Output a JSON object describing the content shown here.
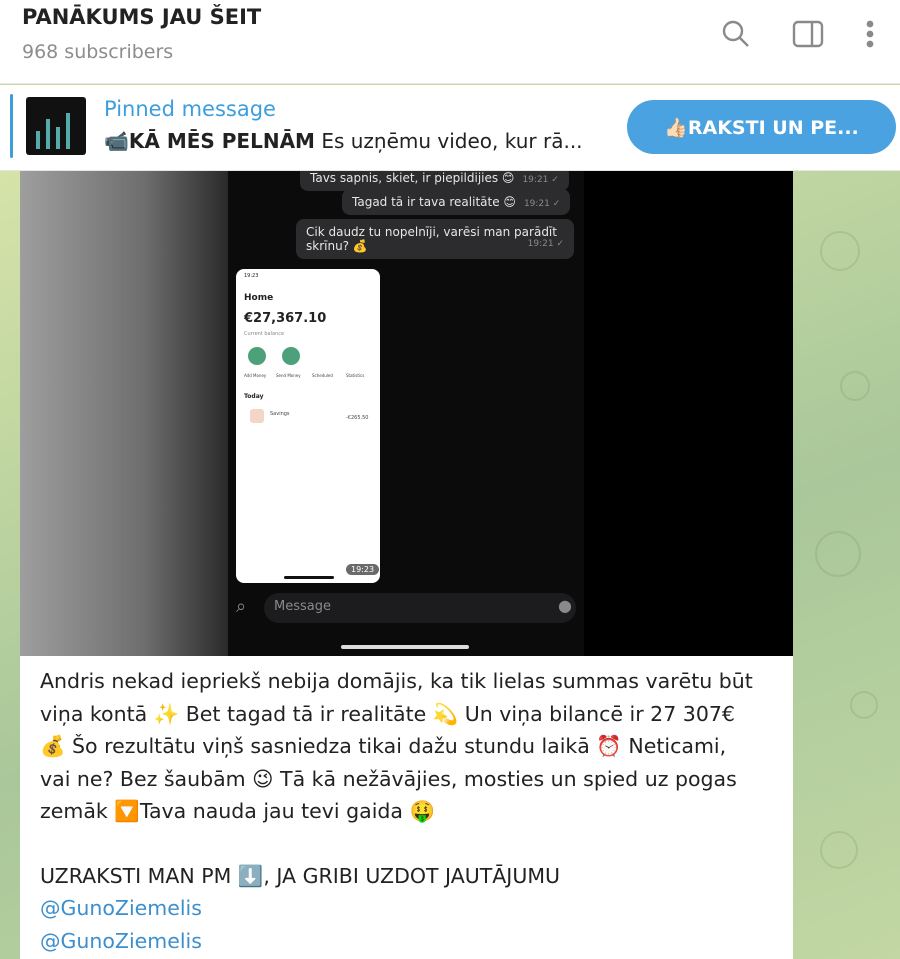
{
  "header": {
    "channel_title": "PANĀKUMS JAU ŠEIT",
    "subscribers": "968 subscribers",
    "icons": [
      "search-icon",
      "sidebar-toggle-icon",
      "more-vertical-icon"
    ]
  },
  "pinned": {
    "label": "Pinned message",
    "emoji": "📹",
    "title_bold": "KĀ MĒS PELNĀM",
    "preview": " Es uzņēmu video, kur rā...",
    "button_label": "👍🏻RAKSTI UN PE..."
  },
  "media": {
    "bubbles": {
      "b1": "Tavs sapnis, skiet, ir piepildijies 😊",
      "b1_time": "19:21 ✓",
      "b2": "Tagad tā ir tava realitāte 😊",
      "b2_time": "19:21 ✓",
      "b3_line1": "Cik daudz tu nopelnīji, varēsi man parādīt",
      "b3_line2": "skrīnu? 💰",
      "b3_time": "19:21 ✓"
    },
    "screen": {
      "status": "19:23",
      "home": "Home",
      "amount": "€27,367.10",
      "sub": "Current balance",
      "actions": [
        "Add Money",
        "Send Money",
        "Scheduled",
        "Statistics"
      ],
      "today": "Today",
      "tx_label": "Savings",
      "tx_sub": "Today",
      "tx_amount": "-€265.50",
      "time": "19:23"
    },
    "input_placeholder": "Message"
  },
  "message": {
    "lines": [
      "Andris nekad iepriekš nebija domājis, ka tik lielas summas varētu būt",
      "viņa kontā ✨ Bet tagad tā ir realitāte 💫 Un viņa bilancē ir 27 307€",
      "💰 Šo rezultātu viņš sasniedza tikai dažu stundu laikā ⏰ Neticami,",
      "vai ne? Bez šaubām 😉 Tā kā nežāvājies, mosties un spied uz pogas",
      "zemāk 🔽Tava nauda jau tevi gaida 🤑"
    ],
    "cta": "UZRAKSTI MAN PM ⬇️, JA GRIBI UZDOT JAUTĀJUMU",
    "link1": "@GunoZiemelis",
    "link2": "@GunoZiemelis"
  },
  "colors": {
    "accent": "#3c9ede",
    "button": "#4aa2e0",
    "link": "#3c8fce"
  }
}
